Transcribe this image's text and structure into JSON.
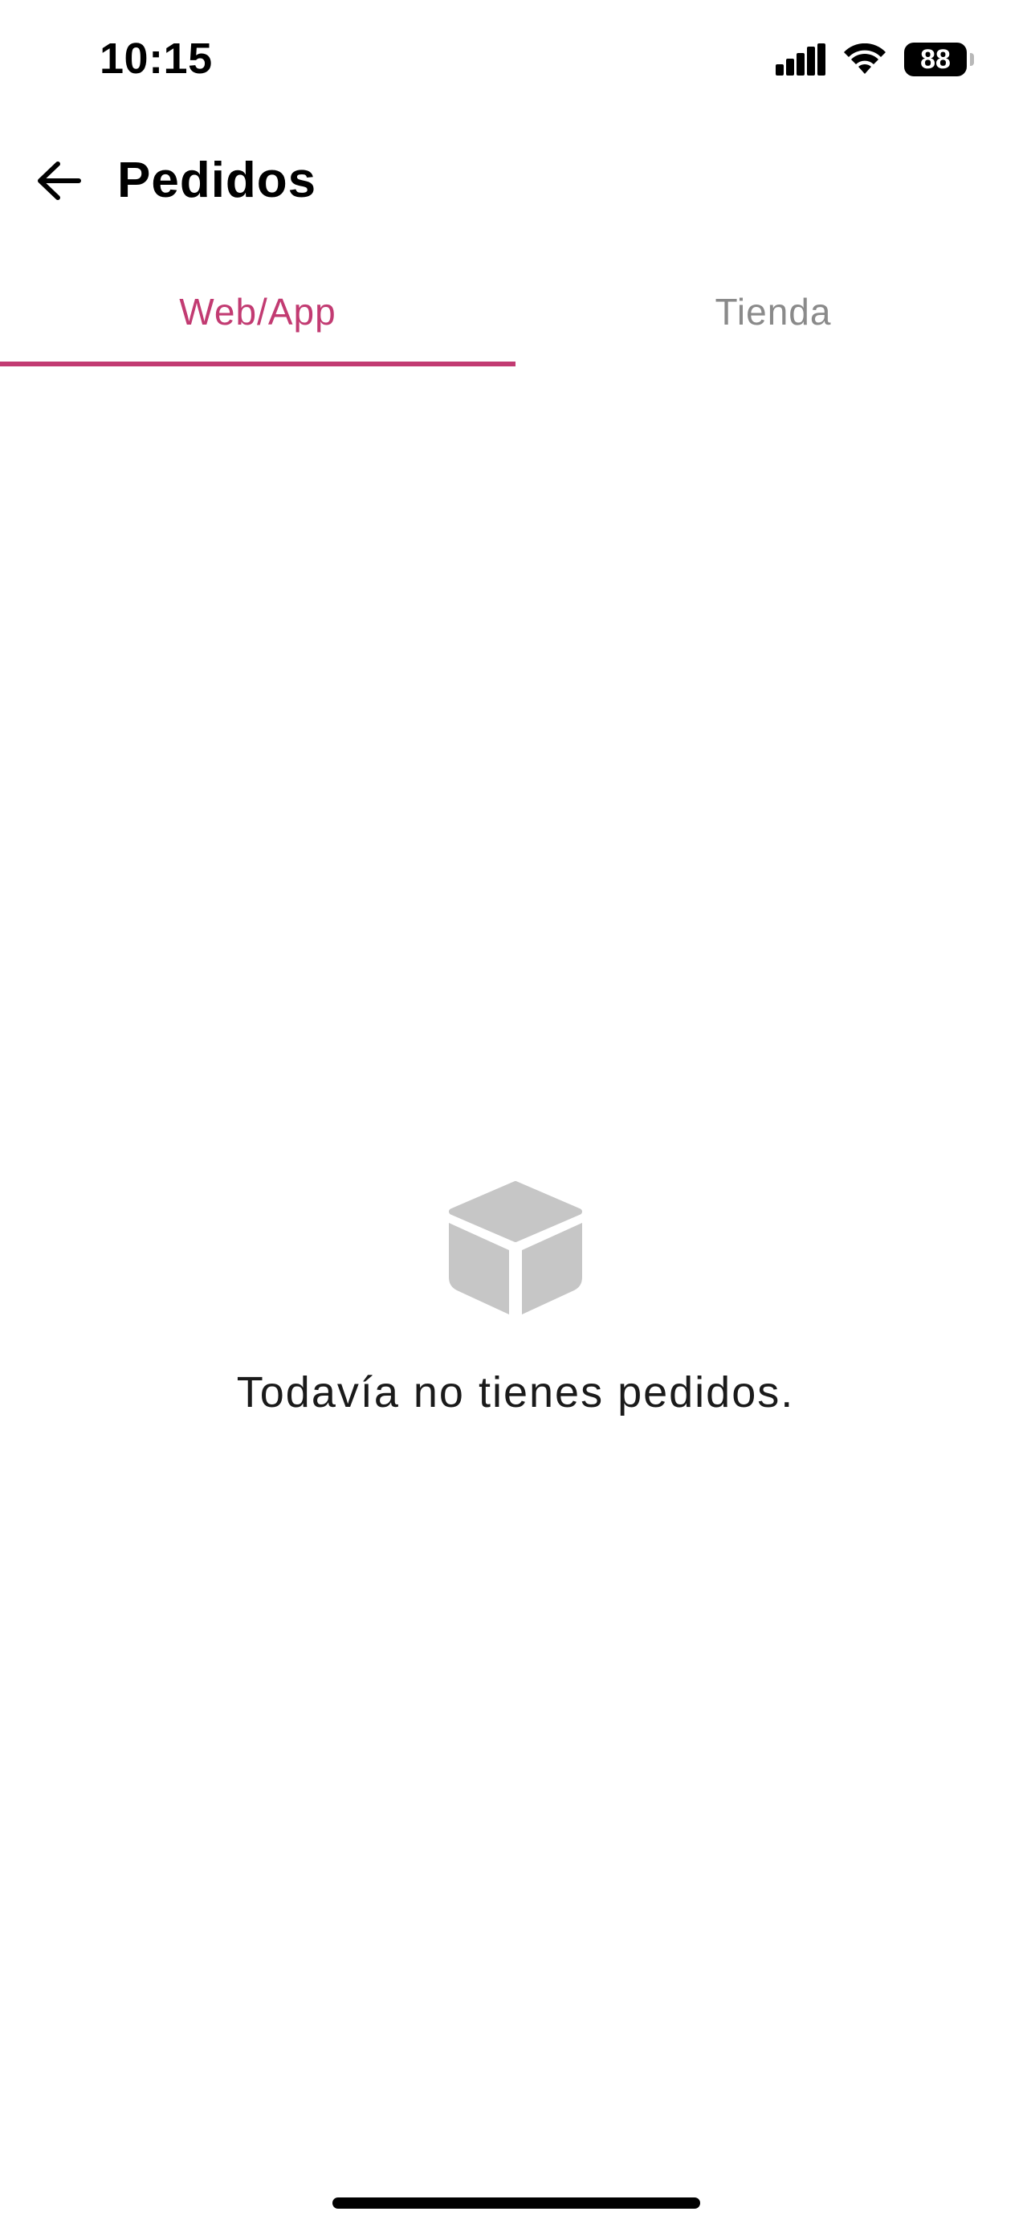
{
  "status_bar": {
    "time": "10:15",
    "battery_level": "88",
    "icons": [
      "signal-icon",
      "wifi-icon",
      "battery-icon"
    ]
  },
  "header": {
    "back_icon": "arrow-left-icon",
    "title": "Pedidos"
  },
  "tabs": [
    {
      "label": "Web/App",
      "active": true
    },
    {
      "label": "Tienda",
      "active": false
    }
  ],
  "empty_state": {
    "icon": "box-icon",
    "message": "Todavía no tienes pedidos."
  },
  "colors": {
    "accent": "#c23b72",
    "inactive_tab": "#8a8a8a",
    "icon_gray": "#c6c6c6"
  }
}
